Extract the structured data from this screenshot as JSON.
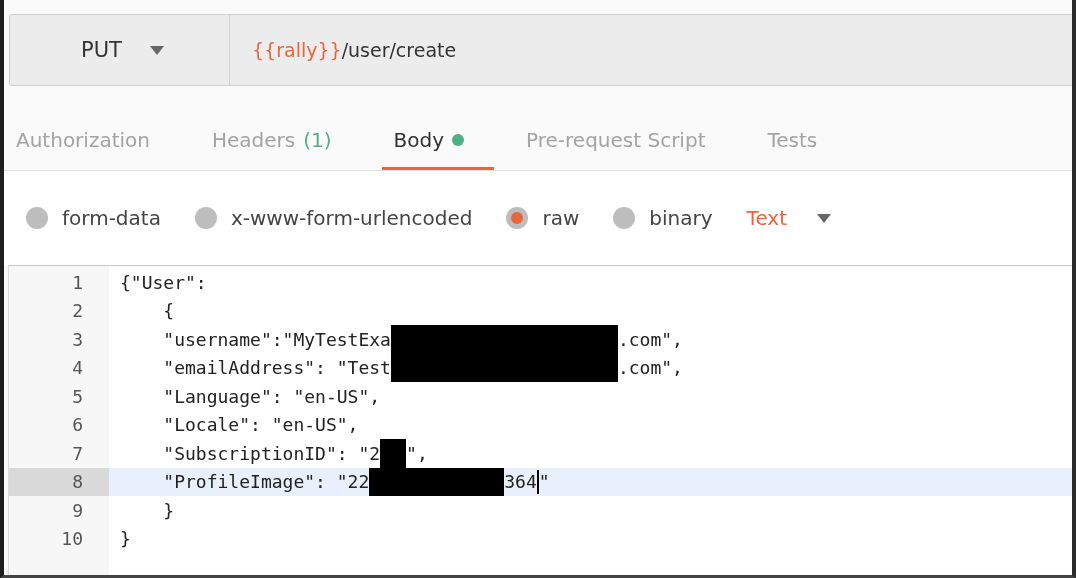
{
  "request": {
    "method": "PUT",
    "url_variable": "{{rally}}",
    "url_path": "/user/create"
  },
  "tabs": [
    {
      "label": "Authorization",
      "selected": false,
      "dot": false
    },
    {
      "label": "Headers",
      "count": "(1)",
      "selected": false,
      "dot": false
    },
    {
      "label": "Body",
      "selected": true,
      "dot": true
    },
    {
      "label": "Pre-request Script",
      "selected": false,
      "dot": false
    },
    {
      "label": "Tests",
      "selected": false,
      "dot": false
    }
  ],
  "body_types": [
    {
      "label": "form-data",
      "selected": false
    },
    {
      "label": "x-www-form-urlencoded",
      "selected": false
    },
    {
      "label": "raw",
      "selected": true
    },
    {
      "label": "binary",
      "selected": false
    }
  ],
  "format": "Text",
  "editor": {
    "lines": [
      {
        "number": "1",
        "active": false,
        "segments": [
          {
            "kind": "text",
            "text": "{\"User\":"
          }
        ]
      },
      {
        "number": "2",
        "active": false,
        "segments": [
          {
            "kind": "text",
            "text": "    {"
          }
        ]
      },
      {
        "number": "3",
        "active": false,
        "segments": [
          {
            "kind": "text",
            "text": "    \"username\":\"MyTestExa"
          },
          {
            "kind": "redaction_wide"
          },
          {
            "kind": "text",
            "text": ".com\","
          }
        ]
      },
      {
        "number": "4",
        "active": false,
        "segments": [
          {
            "kind": "text",
            "text": "    \"emailAddress\": \"Test"
          },
          {
            "kind": "redaction_wide"
          },
          {
            "kind": "text",
            "text": ".com\","
          }
        ]
      },
      {
        "number": "5",
        "active": false,
        "segments": [
          {
            "kind": "text",
            "text": "    \"Language\": \"en-US\","
          }
        ]
      },
      {
        "number": "6",
        "active": false,
        "segments": [
          {
            "kind": "text",
            "text": "    \"Locale\": \"en-US\","
          }
        ]
      },
      {
        "number": "7",
        "active": false,
        "segments": [
          {
            "kind": "text",
            "text": "    \"SubscriptionID\": \"2"
          },
          {
            "kind": "redaction_small"
          },
          {
            "kind": "text",
            "text": "\","
          }
        ]
      },
      {
        "number": "8",
        "active": true,
        "segments": [
          {
            "kind": "text",
            "text": "    \"ProfileImage\": \"22"
          },
          {
            "kind": "redaction_medium"
          },
          {
            "kind": "text",
            "text": "364"
          },
          {
            "kind": "cursor"
          },
          {
            "kind": "text",
            "text": "\""
          }
        ]
      },
      {
        "number": "9",
        "active": false,
        "segments": [
          {
            "kind": "text",
            "text": "    }"
          }
        ]
      },
      {
        "number": "10",
        "active": false,
        "segments": [
          {
            "kind": "text",
            "text": "}"
          }
        ]
      }
    ]
  }
}
